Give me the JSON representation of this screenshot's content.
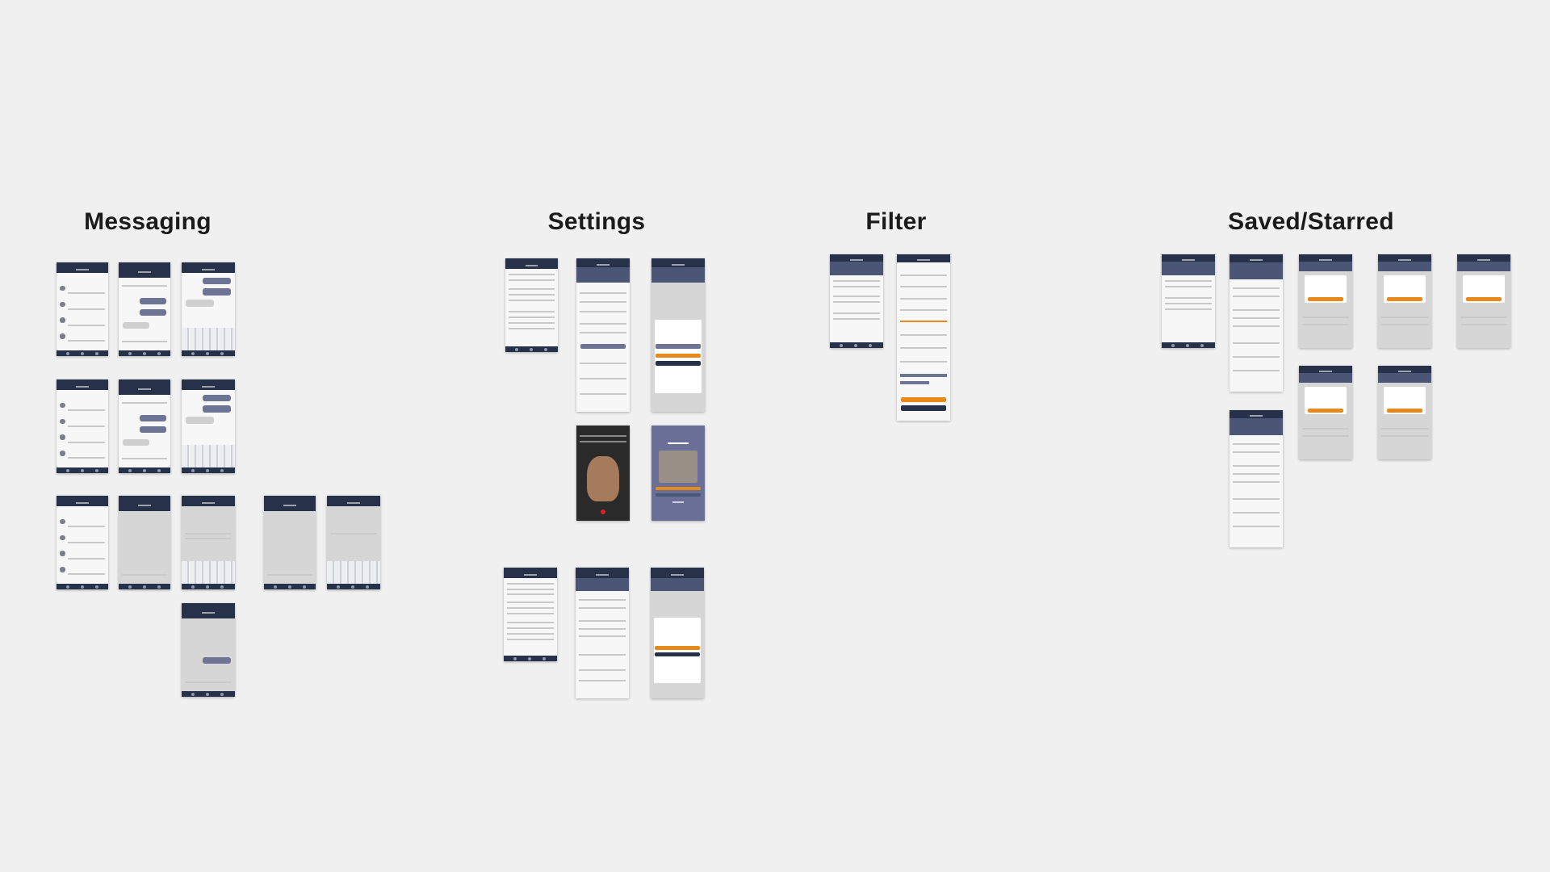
{
  "canvas": {
    "background": "#f0f0f0"
  },
  "sections": {
    "messaging": "Messaging",
    "settings": "Settings",
    "filter": "Filter",
    "saved": "Saved/Starred"
  },
  "colors": {
    "header_navy": "#27314a",
    "accent_orange": "#e8891b",
    "bubble_slate": "#6e7594",
    "video_purple": "#6a6f97",
    "record_red": "#e0202a"
  },
  "screens": {
    "messaging": [
      "list",
      "chat",
      "chat-keyboard",
      "list",
      "chat",
      "chat-keyboard",
      "list",
      "empty-chat",
      "compose-keyboard",
      "new-chat",
      "new-chat-keyboard",
      "chat-sent"
    ],
    "settings": [
      "settings-menu",
      "your-profile",
      "profile-actions",
      "record-video",
      "review-video",
      "settings-menu",
      "your-profile",
      "profile-actions"
    ],
    "filter": [
      "search-results",
      "filter-options"
    ],
    "saved": [
      "saved-list",
      "profile",
      "profile",
      "star-confirm",
      "star-confirm",
      "star-confirm",
      "star-confirm",
      "star-confirm",
      "star-confirm"
    ]
  }
}
